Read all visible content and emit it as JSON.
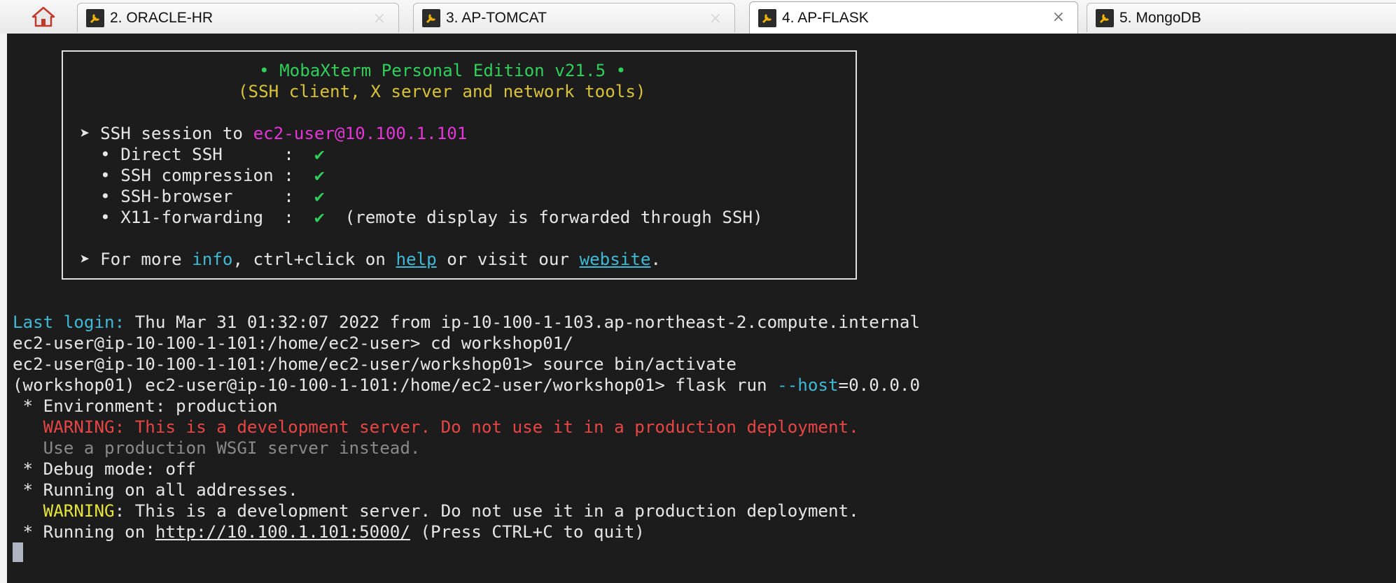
{
  "tabs": [
    {
      "label": "2. ORACLE-HR",
      "active": false
    },
    {
      "label": "3. AP-TOMCAT",
      "active": false
    },
    {
      "label": "4. AP-FLASK",
      "active": true
    },
    {
      "label": "5. MongoDB",
      "active": false
    }
  ],
  "tab_close_glyph": "×",
  "icons": {
    "home": "home-icon",
    "tab": "wrench-icon",
    "close": "close-icon"
  },
  "colors": {
    "terminal_bg": "#1c1c1c",
    "green": "#2fd05a",
    "magenta": "#e535d8",
    "cyan": "#3fb9d6",
    "red": "#e84545",
    "yellow": "#e4e43a"
  },
  "welcome": {
    "title": "• MobaXterm Personal Edition v21.5 •",
    "subtitle": "(SSH client, X server and network tools)",
    "session_prefix": "➤ SSH session to ",
    "session_host": "ec2-user@10.100.1.101",
    "features": [
      {
        "label": "  • Direct SSH      :  ",
        "check": "✔",
        "note": ""
      },
      {
        "label": "  • SSH compression :  ",
        "check": "✔",
        "note": ""
      },
      {
        "label": "  • SSH-browser     :  ",
        "check": "✔",
        "note": ""
      },
      {
        "label": "  • X11-forwarding  :  ",
        "check": "✔",
        "note": "  (remote display is forwarded through SSH)"
      }
    ],
    "more_prefix": "➤ For more ",
    "more_info": "info",
    "more_mid": ", ctrl+click on ",
    "more_help": "help",
    "more_mid2": " or visit our ",
    "more_website": "website",
    "more_end": "."
  },
  "terminal": {
    "last_login_label": "Last login:",
    "last_login_text": " Thu Mar 31 01:32:07 2022 from ip-10-100-1-103.ap-northeast-2.compute.internal",
    "cmd1": "ec2-user@ip-10-100-1-101:/home/ec2-user> cd workshop01/",
    "cmd2": "ec2-user@ip-10-100-1-101:/home/ec2-user/workshop01> source bin/activate",
    "cmd3_prefix": "(workshop01) ec2-user@ip-10-100-1-101:/home/ec2-user/workshop01> flask run ",
    "cmd3_flag": "--host",
    "cmd3_value": "=0.0.0.0",
    "env": " * Environment: production",
    "warning1": "   WARNING: This is a development server. Do not use it in a production deployment.",
    "wsgi": "   Use a production WSGI server instead.",
    "debug": " * Debug mode: off",
    "running_all": " * Running on all addresses.",
    "warning2_label": "   WARNING",
    "warning2_text": ": This is a development server. Do not use it in a production deployment.",
    "running_prefix": " * Running on ",
    "running_url": "http://10.100.1.101:5000/",
    "running_suffix": " (Press CTRL+C to quit)"
  }
}
